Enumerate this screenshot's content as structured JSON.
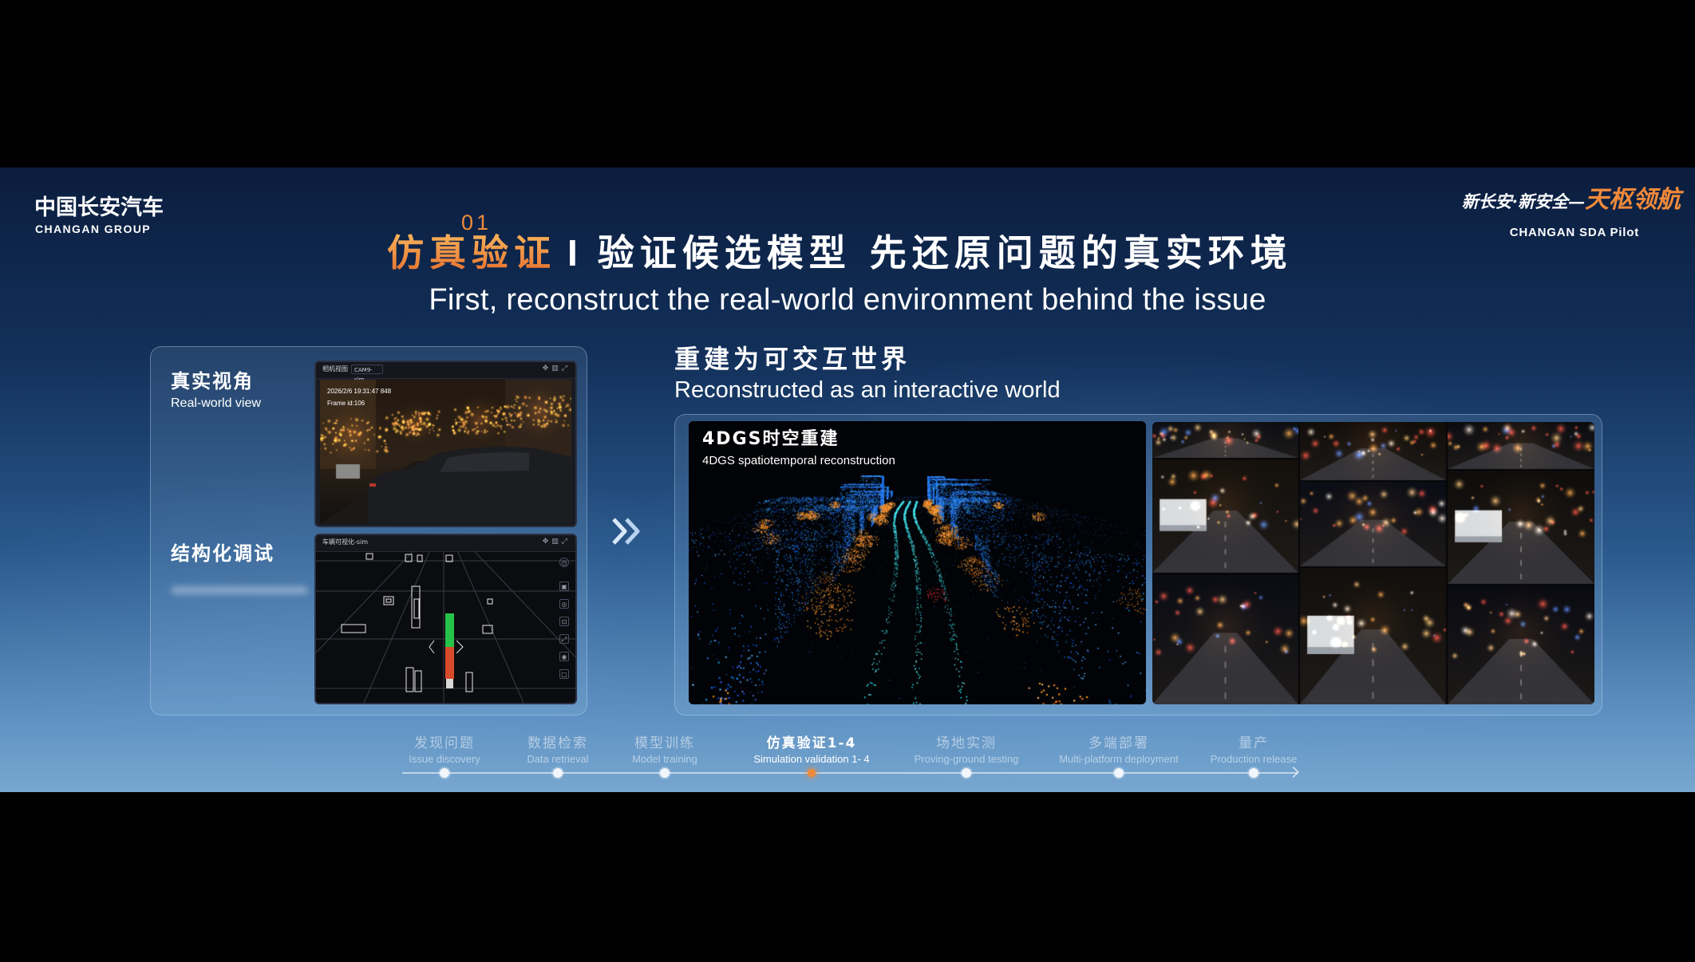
{
  "brand": {
    "cn": "中国长安汽车",
    "en": "CHANGAN GROUP"
  },
  "pilot": {
    "slogan_lead": "新长安·新安全—",
    "slogan_highlight": "天枢领航",
    "en": "CHANGAN SDA Pilot"
  },
  "title": {
    "number": "01",
    "highlight": "仿真验证",
    "separator": "I",
    "rest": "验证候选模型 先还原问题的真实环境",
    "en": "First, reconstruct the real-world environment behind the issue"
  },
  "left_panel": {
    "real_view": {
      "cn": "真实视角",
      "en": "Real-world view"
    },
    "structured_debug": {
      "cn": "结构化调试"
    },
    "camera_view": {
      "title": "相机视图",
      "camera": "CAM9-sim",
      "timestamp": "2026/2/6 19:31:47 848",
      "frame": "Frame id:106"
    },
    "vehicle_viz": {
      "title": "车辆可视化-sim"
    }
  },
  "right_panel": {
    "cn": "重建为可交互世界",
    "en": "Reconstructed as an interactive world",
    "reconstruction": {
      "cn": "4DGS时空重建",
      "en": "4DGS spatiotemporal reconstruction"
    }
  },
  "timeline": [
    {
      "cn": "发现问题",
      "en": "Issue discovery",
      "active": false
    },
    {
      "cn": "数据检索",
      "en": "Data retrieval",
      "active": false
    },
    {
      "cn": "模型训练",
      "en": "Model training",
      "active": false
    },
    {
      "cn": "仿真验证1-4",
      "en": "Simulation validation 1- 4",
      "active": true
    },
    {
      "cn": "场地实测",
      "en": "Proving-ground testing",
      "active": false
    },
    {
      "cn": "多端部署",
      "en": "Multi-platform deployment",
      "active": false
    },
    {
      "cn": "量产",
      "en": "Production release",
      "active": false
    }
  ],
  "colors": {
    "accent": "#f08a3a",
    "slide_top": "#0b1d3e",
    "slide_bottom": "#78a7d0",
    "point_cloud_blue": "#3a8ff0",
    "point_cloud_orange": "#f0903a"
  }
}
